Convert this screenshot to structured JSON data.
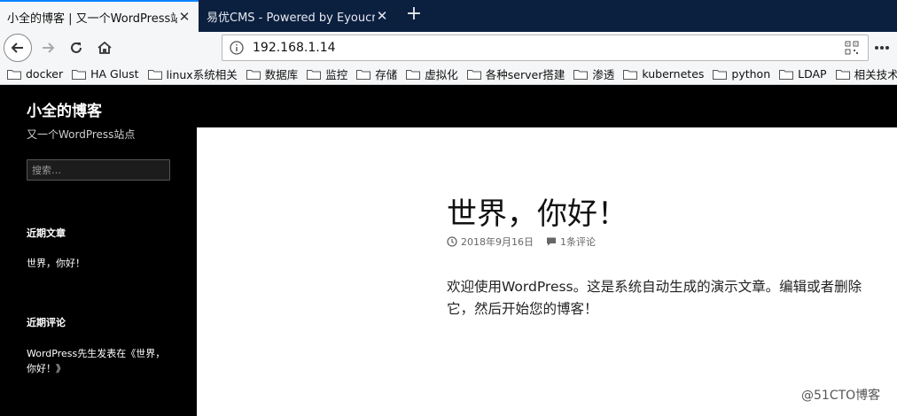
{
  "browser": {
    "tabs": [
      {
        "title": "小全的博客 | 又一个WordPress站点",
        "active": true
      },
      {
        "title": "易优CMS - Powered by Eyoucms",
        "active": false
      }
    ],
    "new_tab_label": "+",
    "url": "192.168.1.14",
    "bookmarks": [
      "docker",
      "HA Glust",
      "linux系统相关",
      "数据库",
      "监控",
      "存储",
      "虚拟化",
      "各种server搭建",
      "渗透",
      "kubernetes",
      "python",
      "LDAP",
      "相关技术"
    ]
  },
  "site": {
    "title": "小全的博客",
    "description": "又一个WordPress站点",
    "search_placeholder": "搜索…",
    "recent_posts_title": "近期文章",
    "recent_post_link": "世界，你好！",
    "recent_comments_title": "近期评论",
    "recent_comment_text": "WordPress先生发表在《世界，你好！》"
  },
  "post": {
    "title": "世界，你好！",
    "date": "2018年9月16日",
    "comments": "1条评论",
    "body": "欢迎使用WordPress。这是系统自动生成的演示文章。编辑或者删除它，然后开始您的博客！"
  },
  "watermark": "@51CTO博客",
  "colors": {
    "accent": "#0a84ff",
    "tabbar": "#0b1f3f",
    "sidebar": "#000000"
  }
}
